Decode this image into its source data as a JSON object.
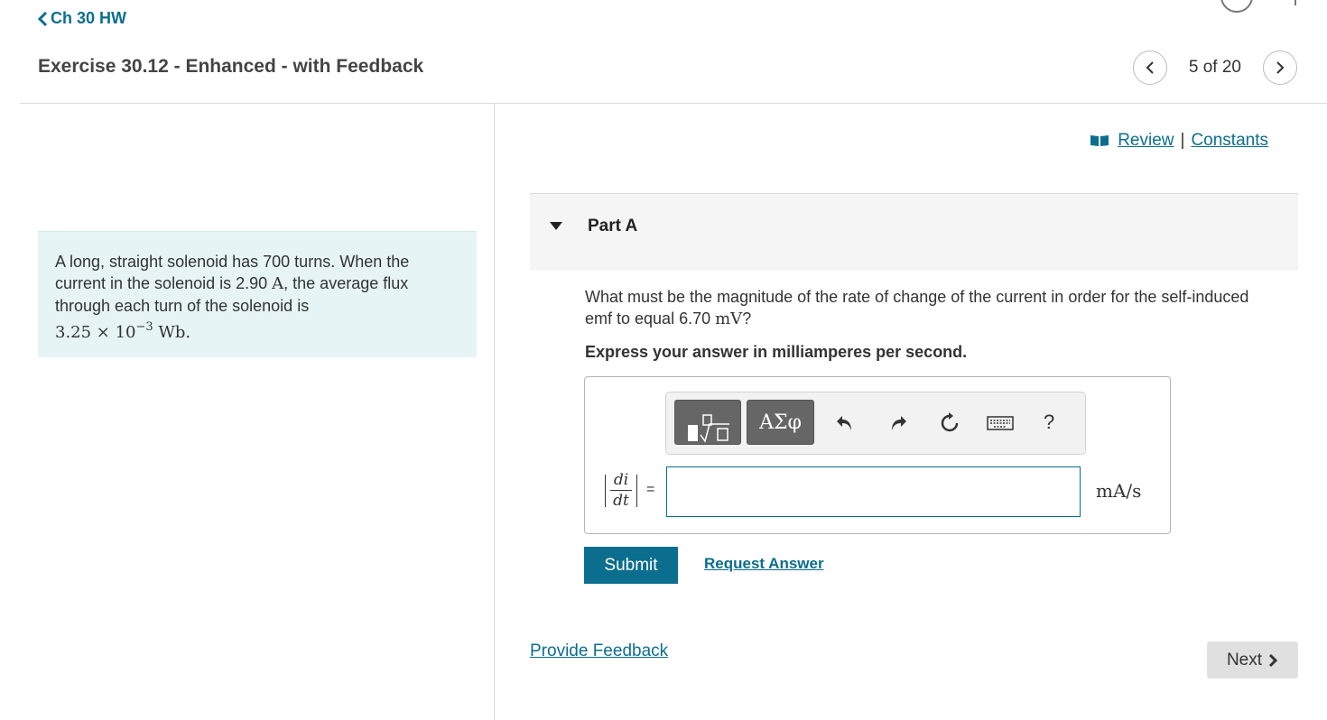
{
  "header": {
    "back_link": "Ch 30 HW",
    "exercise_title": "Exercise 30.12 - Enhanced - with Feedback",
    "pager": {
      "count": "5 of 20"
    }
  },
  "problem": {
    "text": "A long, straight solenoid has 700 turns. When the current in the solenoid is 2.90 ",
    "current_unit": "A",
    "text_2": ", the average flux through each turn of the solenoid is",
    "flux_mantissa": "3.25 × 10",
    "flux_exponent": "−3",
    "flux_unit": " Wb."
  },
  "resources": {
    "review": "Review",
    "separator": "|",
    "constants": "Constants"
  },
  "part": {
    "title": "Part A",
    "question_text": "What must be the magnitude of the rate of change of the current in order for the self-induced emf to equal 6.70 ",
    "question_unit": "mV",
    "question_end": "?",
    "instruction": "Express your answer in milliamperes per second."
  },
  "answer": {
    "toolbar": {
      "symbols_label": "ΑΣφ",
      "help_label": "?"
    },
    "lhs_numerator": "di",
    "lhs_denominator": "dt",
    "equals": "=",
    "input_value": "",
    "units": "mA/s",
    "submit_label": "Submit",
    "request_label": "Request Answer"
  },
  "footer": {
    "feedback_label": "Provide Feedback",
    "next_label": "Next"
  },
  "colors": {
    "accent": "#0b6e8f",
    "problem_bg": "#e6f4f5",
    "part_header_bg": "#f5f5f5",
    "toolbar_button": "#666666"
  },
  "icons": [
    "chevron-left-icon",
    "chevron-right-icon",
    "book-icon",
    "caret-down-icon",
    "templates-icon",
    "undo-icon",
    "redo-icon",
    "reset-icon",
    "keyboard-icon"
  ]
}
